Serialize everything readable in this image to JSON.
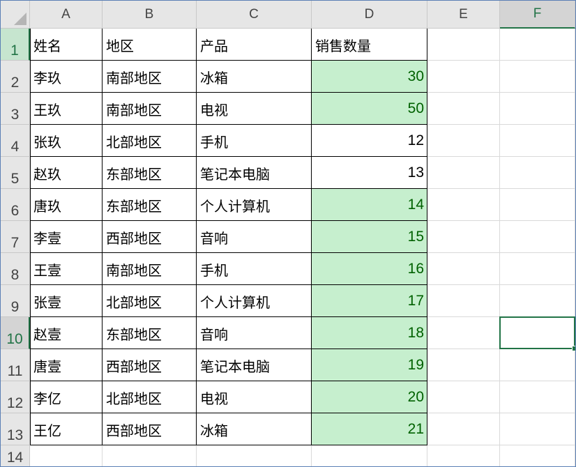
{
  "columns": [
    "A",
    "B",
    "C",
    "D",
    "E",
    "F"
  ],
  "rows": [
    "1",
    "2",
    "3",
    "4",
    "5",
    "6",
    "7",
    "8",
    "9",
    "10",
    "11",
    "12",
    "13",
    "14"
  ],
  "selected_column": "F",
  "selected_row": "10",
  "active_cell": "F10",
  "highlight_color": "#c6efce",
  "highlight_text_color": "#006100",
  "headers": [
    "姓名",
    "地区",
    "产品",
    "销售数量"
  ],
  "data": [
    [
      "李玖",
      "南部地区",
      "冰箱",
      "30",
      true
    ],
    [
      "王玖",
      "南部地区",
      "电视",
      "50",
      true
    ],
    [
      "张玖",
      "北部地区",
      "手机",
      "12",
      false
    ],
    [
      "赵玖",
      "东部地区",
      "笔记本电脑",
      "13",
      false
    ],
    [
      "唐玖",
      "东部地区",
      "个人计算机",
      "14",
      true
    ],
    [
      "李壹",
      "西部地区",
      "音响",
      "15",
      true
    ],
    [
      "王壹",
      "南部地区",
      "手机",
      "16",
      true
    ],
    [
      "张壹",
      "北部地区",
      "个人计算机",
      "17",
      true
    ],
    [
      "赵壹",
      "东部地区",
      "音响",
      "18",
      true
    ],
    [
      "唐壹",
      "西部地区",
      "笔记本电脑",
      "19",
      true
    ],
    [
      "李亿",
      "北部地区",
      "电视",
      "20",
      true
    ],
    [
      "王亿",
      "西部地区",
      "冰箱",
      "21",
      true
    ]
  ]
}
